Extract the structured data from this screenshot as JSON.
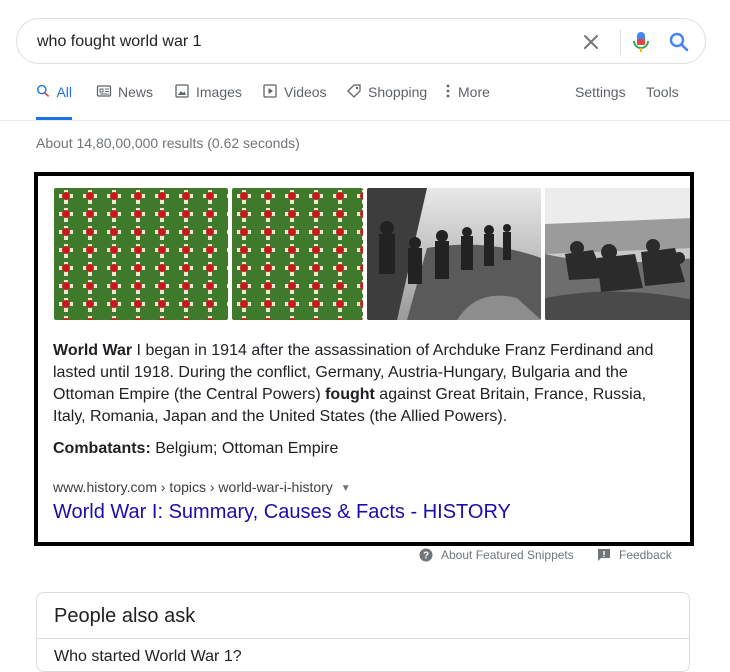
{
  "search": {
    "query": "who fought world war 1"
  },
  "tabs": [
    {
      "label": "All",
      "icon": "search-icon",
      "active": true
    },
    {
      "label": "News",
      "icon": "news-icon"
    },
    {
      "label": "Images",
      "icon": "image-icon"
    },
    {
      "label": "Videos",
      "icon": "video-icon"
    },
    {
      "label": "Shopping",
      "icon": "tag-icon"
    },
    {
      "label": "More",
      "icon": "more-vert-icon"
    }
  ],
  "tools": {
    "settings": "Settings",
    "tools": "Tools"
  },
  "result_stats": "About 14,80,00,000 results (0.62 seconds)",
  "snippet": {
    "images": [
      "poppy-crosses-image",
      "poppy-crosses-image",
      "soldiers-trench-image",
      "soldiers-trench-image"
    ],
    "desc_bold1": "World War",
    "desc_part1": " I began in 1914 after the assassination of Archduke Franz Ferdinand and lasted until 1918. During the conflict, Germany, Austria-Hungary, Bulgaria and the Ottoman Empire (the Central Powers) ",
    "desc_bold2": "fought",
    "desc_part2": " against Great Britain, France, Russia, Italy, Romania, Japan and the United States (the Allied Powers).",
    "combatants_label": "Combatants:",
    "combatants_value": " Belgium; Ottoman Empire",
    "breadcrumb": "www.history.com › topics › world-war-i-history",
    "title": "World War I: Summary, Causes & Facts - HISTORY"
  },
  "snippet_footer": {
    "about": "About Featured Snippets",
    "feedback": "Feedback"
  },
  "paa": {
    "title": "People also ask",
    "first_question": "Who started World War 1?"
  },
  "colors": {
    "link": "#1a0dab",
    "accent": "#1a73e8",
    "mic_blue": "#4285f4",
    "mic_red": "#ea4335"
  }
}
